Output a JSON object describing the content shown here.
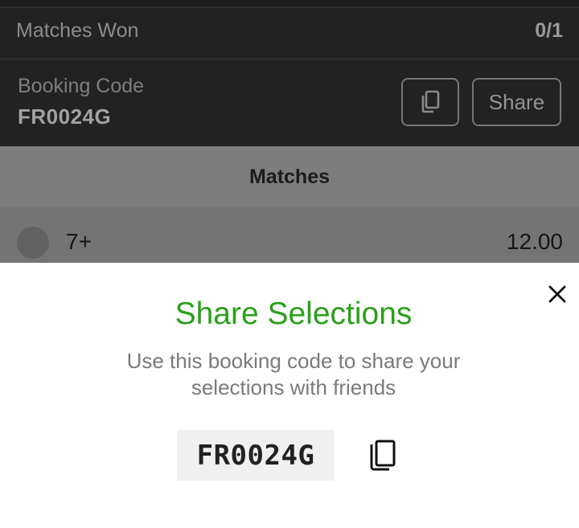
{
  "summary": {
    "matches_won_label": "Matches Won",
    "matches_won_value": "0/1",
    "booking_code_label": "Booking Code",
    "booking_code_value": "FR0024G",
    "share_label": "Share"
  },
  "section": {
    "matches_header": "Matches"
  },
  "match": {
    "selection": "7+",
    "odds": "12.00"
  },
  "share_sheet": {
    "title": "Share Selections",
    "description": "Use this booking code to share your selections with friends",
    "code": "FR0024G"
  },
  "icons": {
    "close": "close-icon",
    "copy": "copy-icon"
  },
  "colors": {
    "accent_green": "#2aa01a",
    "sheet_background": "#ffffff",
    "code_background": "#f0f0f0",
    "dimmed_background": "#222222"
  }
}
